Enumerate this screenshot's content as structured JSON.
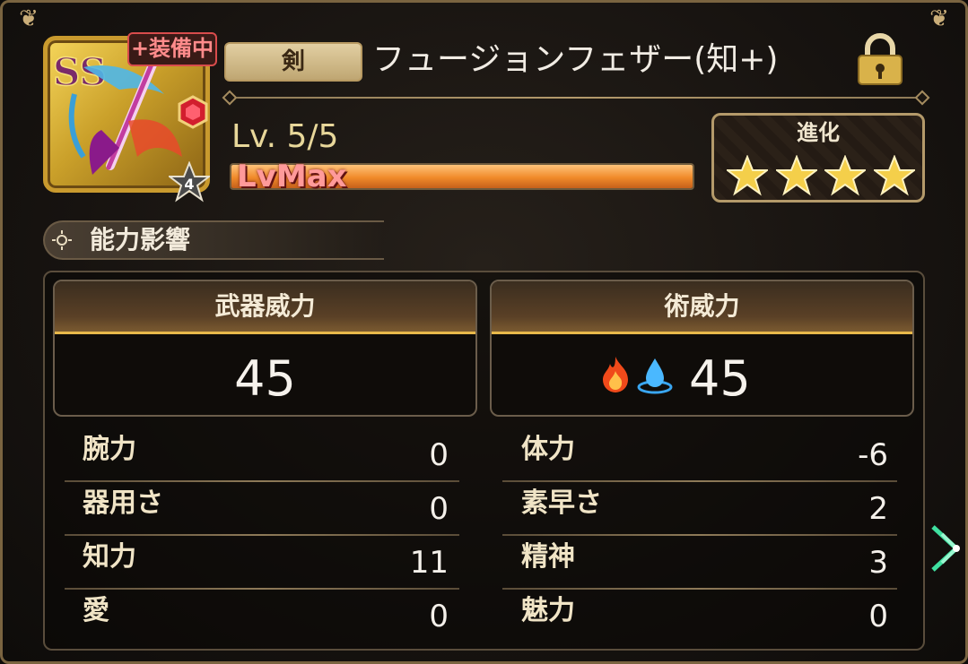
{
  "item": {
    "equipped_badge": "+装備中",
    "type_tag": "剣",
    "name": "フュージョンフェザー(知+)",
    "rank": "4",
    "level_text": "Lv. 5/5",
    "xp_label": "LvMax",
    "xp_fraction": 1.0,
    "locked": true,
    "evolution": {
      "label": "進化",
      "stars_filled": 4,
      "stars_total": 4
    }
  },
  "section": {
    "title": "能力影響"
  },
  "power": {
    "weapon": {
      "title": "武器威力",
      "value": "45"
    },
    "skill": {
      "title": "術威力",
      "value": "45",
      "elements": [
        "fire-icon",
        "water-icon"
      ]
    }
  },
  "stats": {
    "left": [
      {
        "label": "腕力",
        "value": "0"
      },
      {
        "label": "器用さ",
        "value": "0"
      },
      {
        "label": "知力",
        "value": "11"
      },
      {
        "label": "愛",
        "value": "0"
      }
    ],
    "right": [
      {
        "label": "体力",
        "value": "-6"
      },
      {
        "label": "素早さ",
        "value": "2"
      },
      {
        "label": "精神",
        "value": "3"
      },
      {
        "label": "魅力",
        "value": "0"
      }
    ]
  },
  "colors": {
    "accent_gold": "#e8b84a",
    "xp_orange": "#f08a2a",
    "equipped_red": "#d84c4c",
    "nav_arrow": "#3fe0a0"
  }
}
